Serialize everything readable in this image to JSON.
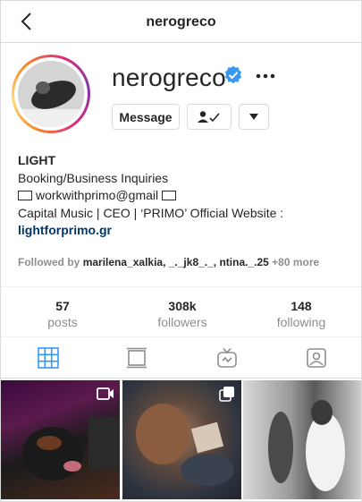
{
  "header": {
    "title": "nerogreco"
  },
  "profile": {
    "username": "nerogreco",
    "buttons": {
      "message": "Message"
    },
    "bio": {
      "name": "LIGHT",
      "line1": "Booking/Business Inquiries",
      "email": "workwithprimo@gmail",
      "line3": "Capital Music | CEO | ‘PRIMO’ Official Website :",
      "link": "lightforprimo.gr"
    },
    "followed_by": {
      "prefix": "Followed by",
      "names": "marilena_xalkia, _._jk8_._, ntina._.25",
      "more": "+80 more"
    }
  },
  "stats": [
    {
      "value": "57",
      "label": "posts"
    },
    {
      "value": "308k",
      "label": "followers"
    },
    {
      "value": "148",
      "label": "following"
    }
  ],
  "colors": {
    "verified": "#3897f0",
    "active_tab": "#3897f0",
    "link": "#00376b"
  }
}
